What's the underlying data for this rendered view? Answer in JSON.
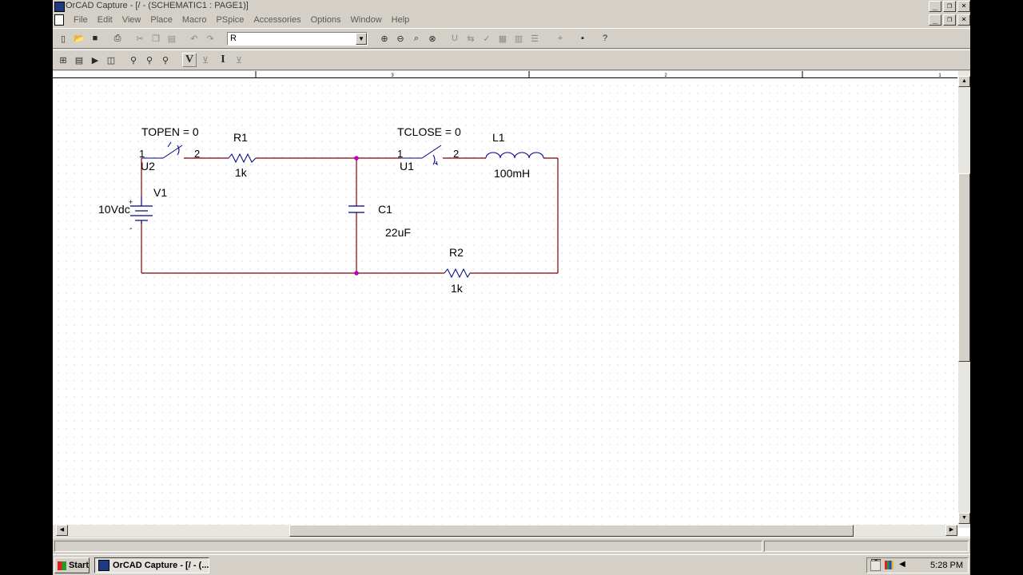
{
  "window": {
    "title": "OrCAD Capture - [/ - (SCHEMATIC1 : PAGE1)]",
    "min_label": "_",
    "restore_label": "❐",
    "close_label": "×"
  },
  "menu": {
    "items": [
      "File",
      "Edit",
      "View",
      "Place",
      "Macro",
      "PSpice",
      "Accessories",
      "Options",
      "Window",
      "Help"
    ]
  },
  "toolbar": {
    "part_combo_value": "R"
  },
  "ruler": {
    "labels": [
      "3",
      "2",
      "1"
    ]
  },
  "schematic": {
    "switch_open": {
      "param": "TOPEN = 0",
      "ref": "U2",
      "pin1": "1",
      "pin2": "2"
    },
    "switch_close": {
      "param": "TCLOSE = 0",
      "ref": "U1",
      "pin1": "1",
      "pin2": "2"
    },
    "r1": {
      "ref": "R1",
      "value": "1k"
    },
    "r2": {
      "ref": "R2",
      "value": "1k"
    },
    "l1": {
      "ref": "L1",
      "value": "100mH"
    },
    "c1": {
      "ref": "C1",
      "value": "22uF"
    },
    "v1": {
      "ref": "V1",
      "value": "10Vdc",
      "plus": "+",
      "minus": "-"
    },
    "colors": {
      "wire": "#800000",
      "part": "#000080",
      "junction": "#c000c0",
      "grid_dot": "#c0c0c0"
    }
  },
  "taskbar": {
    "start_label": "Start",
    "task_label": "OrCAD Capture - [/ - (...",
    "help_label": "?",
    "time": "5:28 PM"
  }
}
